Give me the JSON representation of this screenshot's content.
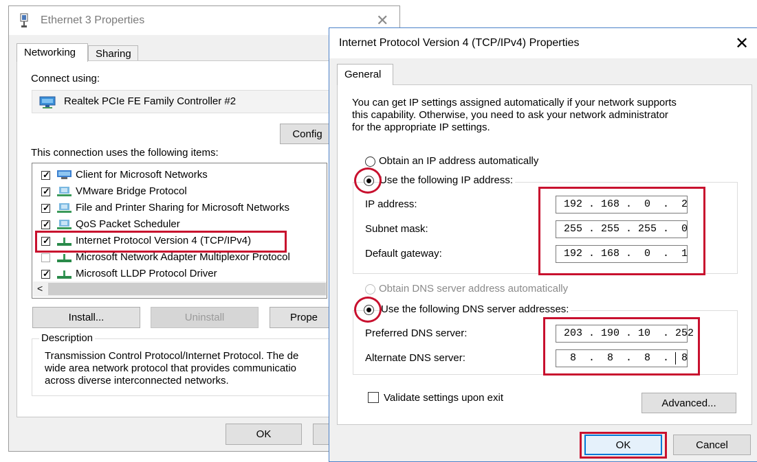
{
  "ethernet_window": {
    "title": "Ethernet 3 Properties",
    "tabs": [
      {
        "label": "Networking"
      },
      {
        "label": "Sharing"
      }
    ],
    "connect_using_label": "Connect using:",
    "adapter_name": "Realtek PCIe FE Family Controller #2",
    "configure_button": "Config",
    "items_label": "This connection uses the following items:",
    "items": [
      {
        "label": "Client for Microsoft Networks",
        "checked": true,
        "icon": "network-client-icon"
      },
      {
        "label": "VMware Bridge Protocol",
        "checked": true,
        "icon": "network-service-icon"
      },
      {
        "label": "File and Printer Sharing for Microsoft Networks",
        "checked": true,
        "icon": "network-service-icon"
      },
      {
        "label": "QoS Packet Scheduler",
        "checked": true,
        "icon": "network-service-icon"
      },
      {
        "label": "Internet Protocol Version 4 (TCP/IPv4)",
        "checked": true,
        "icon": "network-protocol-icon"
      },
      {
        "label": "Microsoft Network Adapter Multiplexor Protocol",
        "checked": false,
        "icon": "network-protocol-icon"
      },
      {
        "label": "Microsoft LLDP Protocol Driver",
        "checked": true,
        "icon": "network-protocol-icon"
      }
    ],
    "scroll_left_glyph": "<",
    "install_button": "Install...",
    "uninstall_button": "Uninstall",
    "properties_button": "Prope",
    "description_label": "Description",
    "description_lines": [
      "Transmission Control Protocol/Internet Protocol. The de",
      "wide area network protocol that provides communicatio",
      "across diverse interconnected networks."
    ],
    "ok_button": "OK"
  },
  "ipv4_dialog": {
    "title": "Internet Protocol Version 4 (TCP/IPv4) Properties",
    "close_glyph": "✕",
    "tab_general": "General",
    "intro_lines": [
      "You can get IP settings assigned automatically if your network supports",
      "this capability. Otherwise, you need to ask your network administrator",
      "for the appropriate IP settings."
    ],
    "radio_obtain_ip": "Obtain an IP address automatically",
    "radio_use_ip": "Use the following IP address:",
    "ip_address_label": "IP address:",
    "ip_address": "192 . 168 .  0  .  2",
    "subnet_mask_label": "Subnet mask:",
    "subnet_mask": "255 . 255 . 255 .  0",
    "default_gateway_label": "Default gateway:",
    "default_gateway": "192 . 168 .  0  .  1",
    "radio_obtain_dns": "Obtain DNS server address automatically",
    "radio_use_dns": "Use the following DNS server addresses:",
    "preferred_dns_label": "Preferred DNS server:",
    "preferred_dns": "203 . 190 . 10  . 252",
    "alternate_dns_label": "Alternate DNS server:",
    "alternate_dns": " 8  .  8  .  8  .  8",
    "validate_label": "Validate settings upon exit",
    "advanced_button": "Advanced...",
    "ok_button": "OK",
    "cancel_button": "Cancel"
  },
  "colors": {
    "highlight_red": "#c8102e",
    "dialog_border": "#4a80c8"
  }
}
